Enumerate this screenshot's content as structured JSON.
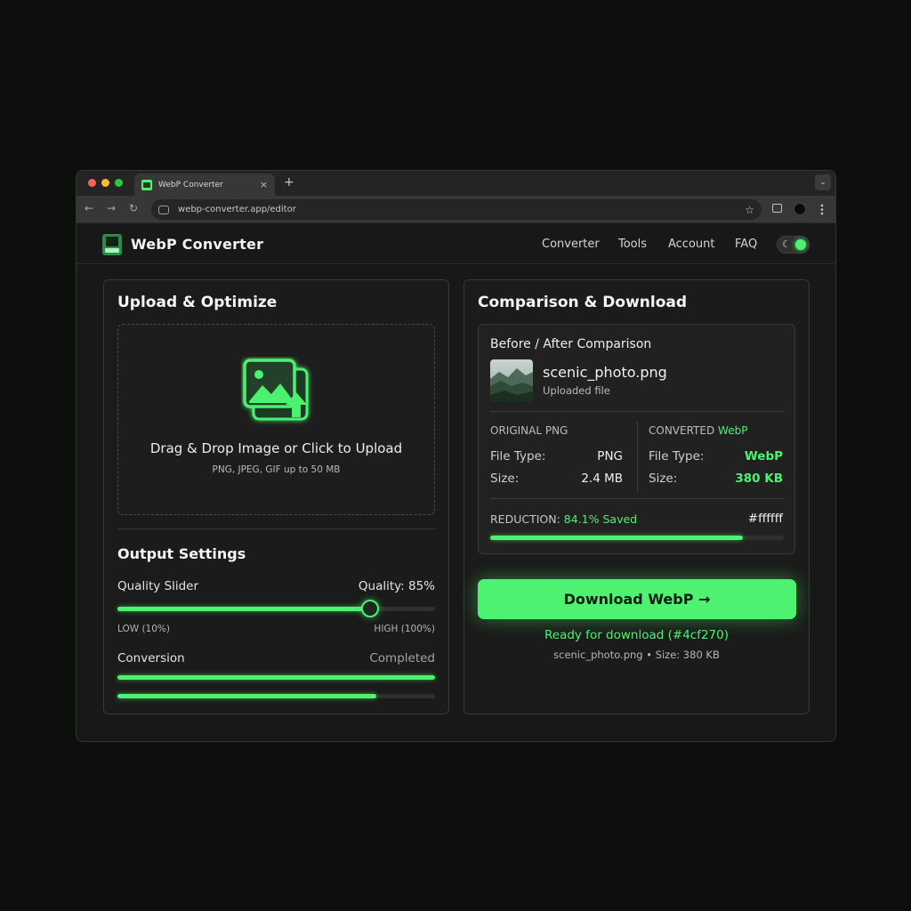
{
  "browser": {
    "tab_title": "WebP Converter",
    "tab_close": "×",
    "new_tab": "+",
    "url": "webp-converter.app/editor",
    "back": "←",
    "forward": "→",
    "reload": "↻",
    "star": "☆",
    "tab_menu": "⌄"
  },
  "app": {
    "brand": "WebP Converter",
    "nav": [
      "Converter",
      "Tools",
      "Account",
      "FAQ"
    ],
    "theme_icon": "☾"
  },
  "upload": {
    "title": "Upload & Optimize",
    "drop_title": "Drag & Drop Image or Click to Upload",
    "drop_sub": "PNG, JPEG, GIF up to 50 MB"
  },
  "settings": {
    "title": "Output Settings",
    "quality_label": "Quality Slider",
    "quality_value": "Quality: 85%",
    "quality_fraction": 0.795,
    "low_label": "LOW (10%)",
    "high_label": "HIGH (100%)",
    "conversion_label": "Conversion",
    "conversion_status": "Completed",
    "conversion_bar_1": 1.0,
    "conversion_bar_2": 0.816
  },
  "comparison": {
    "title": "Comparison & Download",
    "card_title": "Before / After Comparison",
    "file_name": "scenic_photo.png",
    "file_sub": "Uploaded file",
    "original_head": "ORIGINAL PNG",
    "converted_head": "CONVERTED",
    "converted_head_format": "WebP",
    "file_type_label": "File Type:",
    "size_label": "Size:",
    "original_type": "PNG",
    "original_size": "2.4 MB",
    "converted_type": "WebP",
    "converted_size": "380 KB",
    "reduction_label": "REDUCTION:",
    "reduction_value": "84.1% Saved",
    "reduction_fraction": 0.86,
    "color_code": "#ffffff"
  },
  "download": {
    "button_label": "Download WebP →",
    "ready_text": "Ready for download (#4cf270)",
    "meta": "scenic_photo.png • Size: 380 KB"
  },
  "colors": {
    "accent": "#4cf270",
    "background": "#0d0f0d",
    "panel": "#1a1b1a"
  }
}
